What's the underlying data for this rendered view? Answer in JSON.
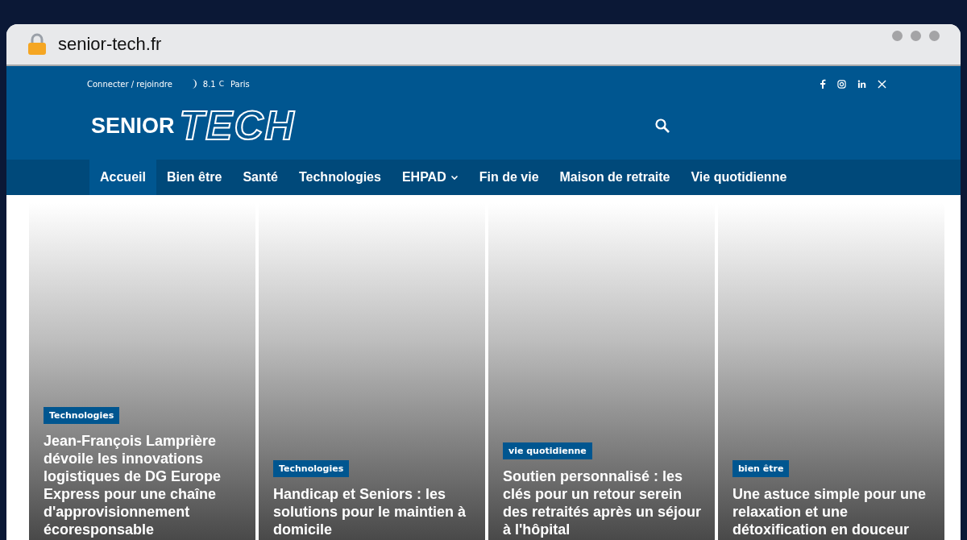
{
  "browser": {
    "url": "senior-tech.fr"
  },
  "topbar": {
    "login": "Connecter / rejoindre",
    "temperature": "8.1",
    "unit": "C",
    "city": "Paris"
  },
  "logo": {
    "word": "SENIOR",
    "accent": "TECH"
  },
  "nav": [
    {
      "label": "Accueil",
      "selected": true,
      "dropdown": false
    },
    {
      "label": "Bien être",
      "selected": false,
      "dropdown": false
    },
    {
      "label": "Santé",
      "selected": false,
      "dropdown": false
    },
    {
      "label": "Technologies",
      "selected": false,
      "dropdown": false
    },
    {
      "label": "EHPAD",
      "selected": false,
      "dropdown": true
    },
    {
      "label": "Fin de vie",
      "selected": false,
      "dropdown": false
    },
    {
      "label": "Maison de retraite",
      "selected": false,
      "dropdown": false
    },
    {
      "label": "Vie quotidienne",
      "selected": false,
      "dropdown": false
    }
  ],
  "articles": [
    {
      "category": "Technologies",
      "title": "Jean-François Lamprière dévoile les innovations logistiques de DG Europe Express pour une chaîne d'approvisionnement écoresponsable"
    },
    {
      "category": "Technologies",
      "title": "Handicap et Seniors : les solutions pour le maintien à domicile"
    },
    {
      "category": "vie quotidienne",
      "title": "Soutien personnalisé : les clés pour un retour serein des retraités après un séjour à l'hôpital"
    },
    {
      "category": "bien être",
      "title": "Une astuce simple pour une relaxation et une détoxification en douceur"
    }
  ]
}
